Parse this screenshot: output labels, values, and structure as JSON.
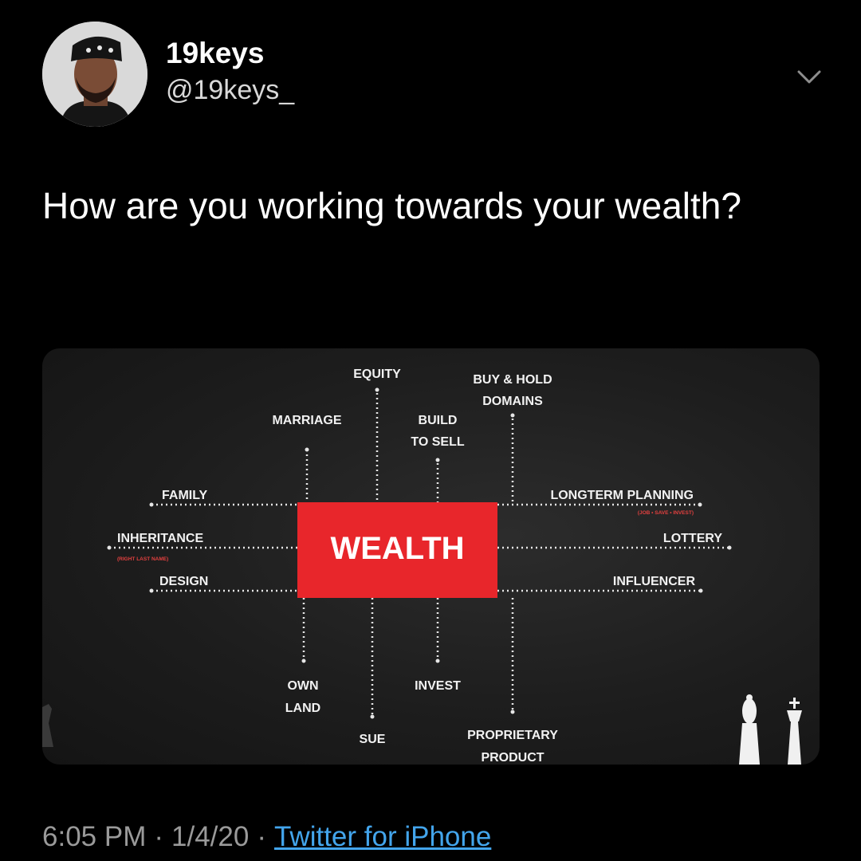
{
  "tweet": {
    "author": {
      "display_name": "19keys",
      "handle": "@19keys_"
    },
    "text": "How are you working towards your wealth?",
    "timestamp": {
      "time": "6:05 PM",
      "date": "1/4/20",
      "separator": "·",
      "source": "Twitter for iPhone"
    }
  },
  "icons": {
    "menu": "chevron-down-icon",
    "pieces": "chess-pieces-icon"
  },
  "colors": {
    "background": "#000000",
    "center_box": "#e8262b",
    "link": "#43a5ec",
    "subtext": "#e2403f"
  },
  "diagram": {
    "center": "WEALTH",
    "labels": {
      "equity": "EQUITY",
      "buy_hold_1": "BUY & HOLD",
      "buy_hold_2": "DOMAINS",
      "marriage": "MARRIAGE",
      "build_1": "BUILD",
      "build_2": "TO SELL",
      "family": "FAMILY",
      "inheritance": "INHERITANCE",
      "inheritance_sub": "(RIGHT LAST NAME)",
      "design": "DESIGN",
      "longterm": "LONGTERM PLANNING",
      "longterm_sub": "(JOB • SAVE • INVEST)",
      "lottery": "LOTTERY",
      "influencer": "INFLUENCER",
      "own_1": "OWN",
      "own_2": "LAND",
      "invest": "INVEST",
      "sue": "SUE",
      "prop_1": "PROPRIETARY",
      "prop_2": "PRODUCT"
    }
  }
}
